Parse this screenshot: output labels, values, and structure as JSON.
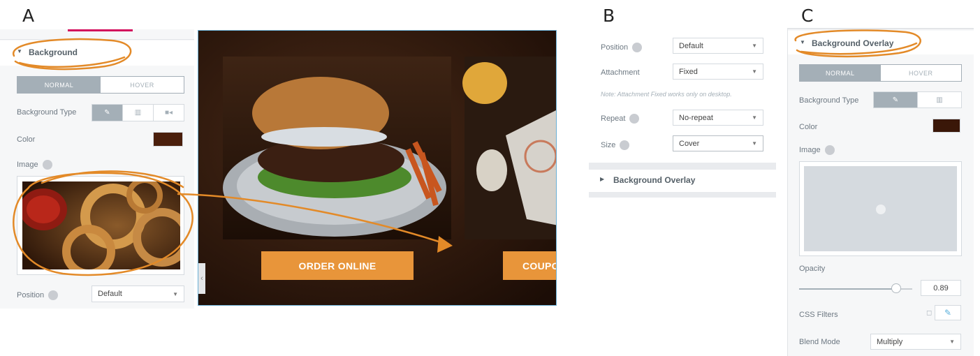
{
  "letters": {
    "a": "A",
    "b": "B",
    "c": "C"
  },
  "panel_a": {
    "section_title": "Background",
    "tabs": {
      "normal": "NORMAL",
      "hover": "HOVER"
    },
    "background_type_label": "Background Type",
    "color_label": "Color",
    "color_value": "#4a1f0c",
    "image_label": "Image",
    "position_label": "Position",
    "position_value": "Default"
  },
  "preview": {
    "button_1": "ORDER ONLINE",
    "button_2": "COUPO"
  },
  "panel_b": {
    "position_label": "Position",
    "position_value": "Default",
    "attachment_label": "Attachment",
    "attachment_value": "Fixed",
    "note": "Note: Attachment Fixed works only on desktop.",
    "repeat_label": "Repeat",
    "repeat_value": "No-repeat",
    "size_label": "Size",
    "size_value": "Cover",
    "overlay_title": "Background Overlay"
  },
  "panel_c": {
    "section_title": "Background Overlay",
    "tabs": {
      "normal": "NORMAL",
      "hover": "HOVER"
    },
    "background_type_label": "Background Type",
    "color_label": "Color",
    "color_value": "#3a1708",
    "image_label": "Image",
    "opacity_label": "Opacity",
    "opacity_value": "0.89",
    "opacity_level": 0.89,
    "css_filters_label": "CSS Filters",
    "blend_mode_label": "Blend Mode",
    "blend_mode_value": "Multiply"
  },
  "colors": {
    "accent_orange": "#e8953a",
    "pink_tab": "#d30c5c",
    "control_grey": "#a4afb7"
  }
}
